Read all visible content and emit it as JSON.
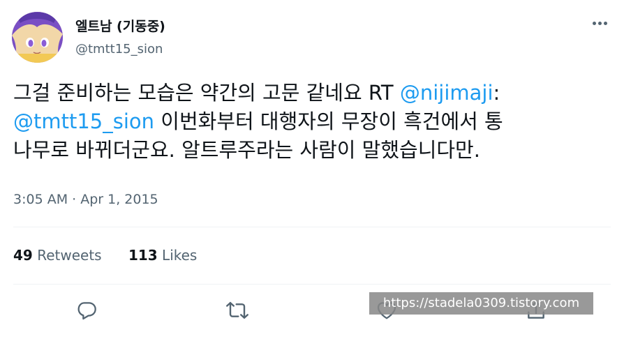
{
  "author": {
    "display_name": "엘트남 (기동중)",
    "handle": "@tmtt15_sion",
    "avatar_icon": "anime-avatar"
  },
  "tweet": {
    "line1_text": "그걸 준비하는 모습은 약간의 고문 같네요 RT ",
    "line1_mention": "@nijimaji",
    "line1_suffix": ":",
    "line2_mention": "@tmtt15_sion",
    "line2_text": " 이번화부터 대행자의 무장이 흑건에서 통",
    "line3_text": "나무로 바뀌더군요. 알트루주라는 사람이 말했습니다만."
  },
  "timestamp": "3:05 AM · Apr 1, 2015",
  "stats": {
    "retweets_count": "49",
    "retweets_label": "Retweets",
    "likes_count": "113",
    "likes_label": "Likes"
  },
  "actions": [
    "reply-icon",
    "retweet-icon",
    "like-icon",
    "share-icon"
  ],
  "watermark": "https://stadela0309.tistory.com",
  "colors": {
    "link": "#1d9bf0",
    "secondary_text": "#536471",
    "primary_text": "#0f1419",
    "divider": "#eff3f4"
  }
}
